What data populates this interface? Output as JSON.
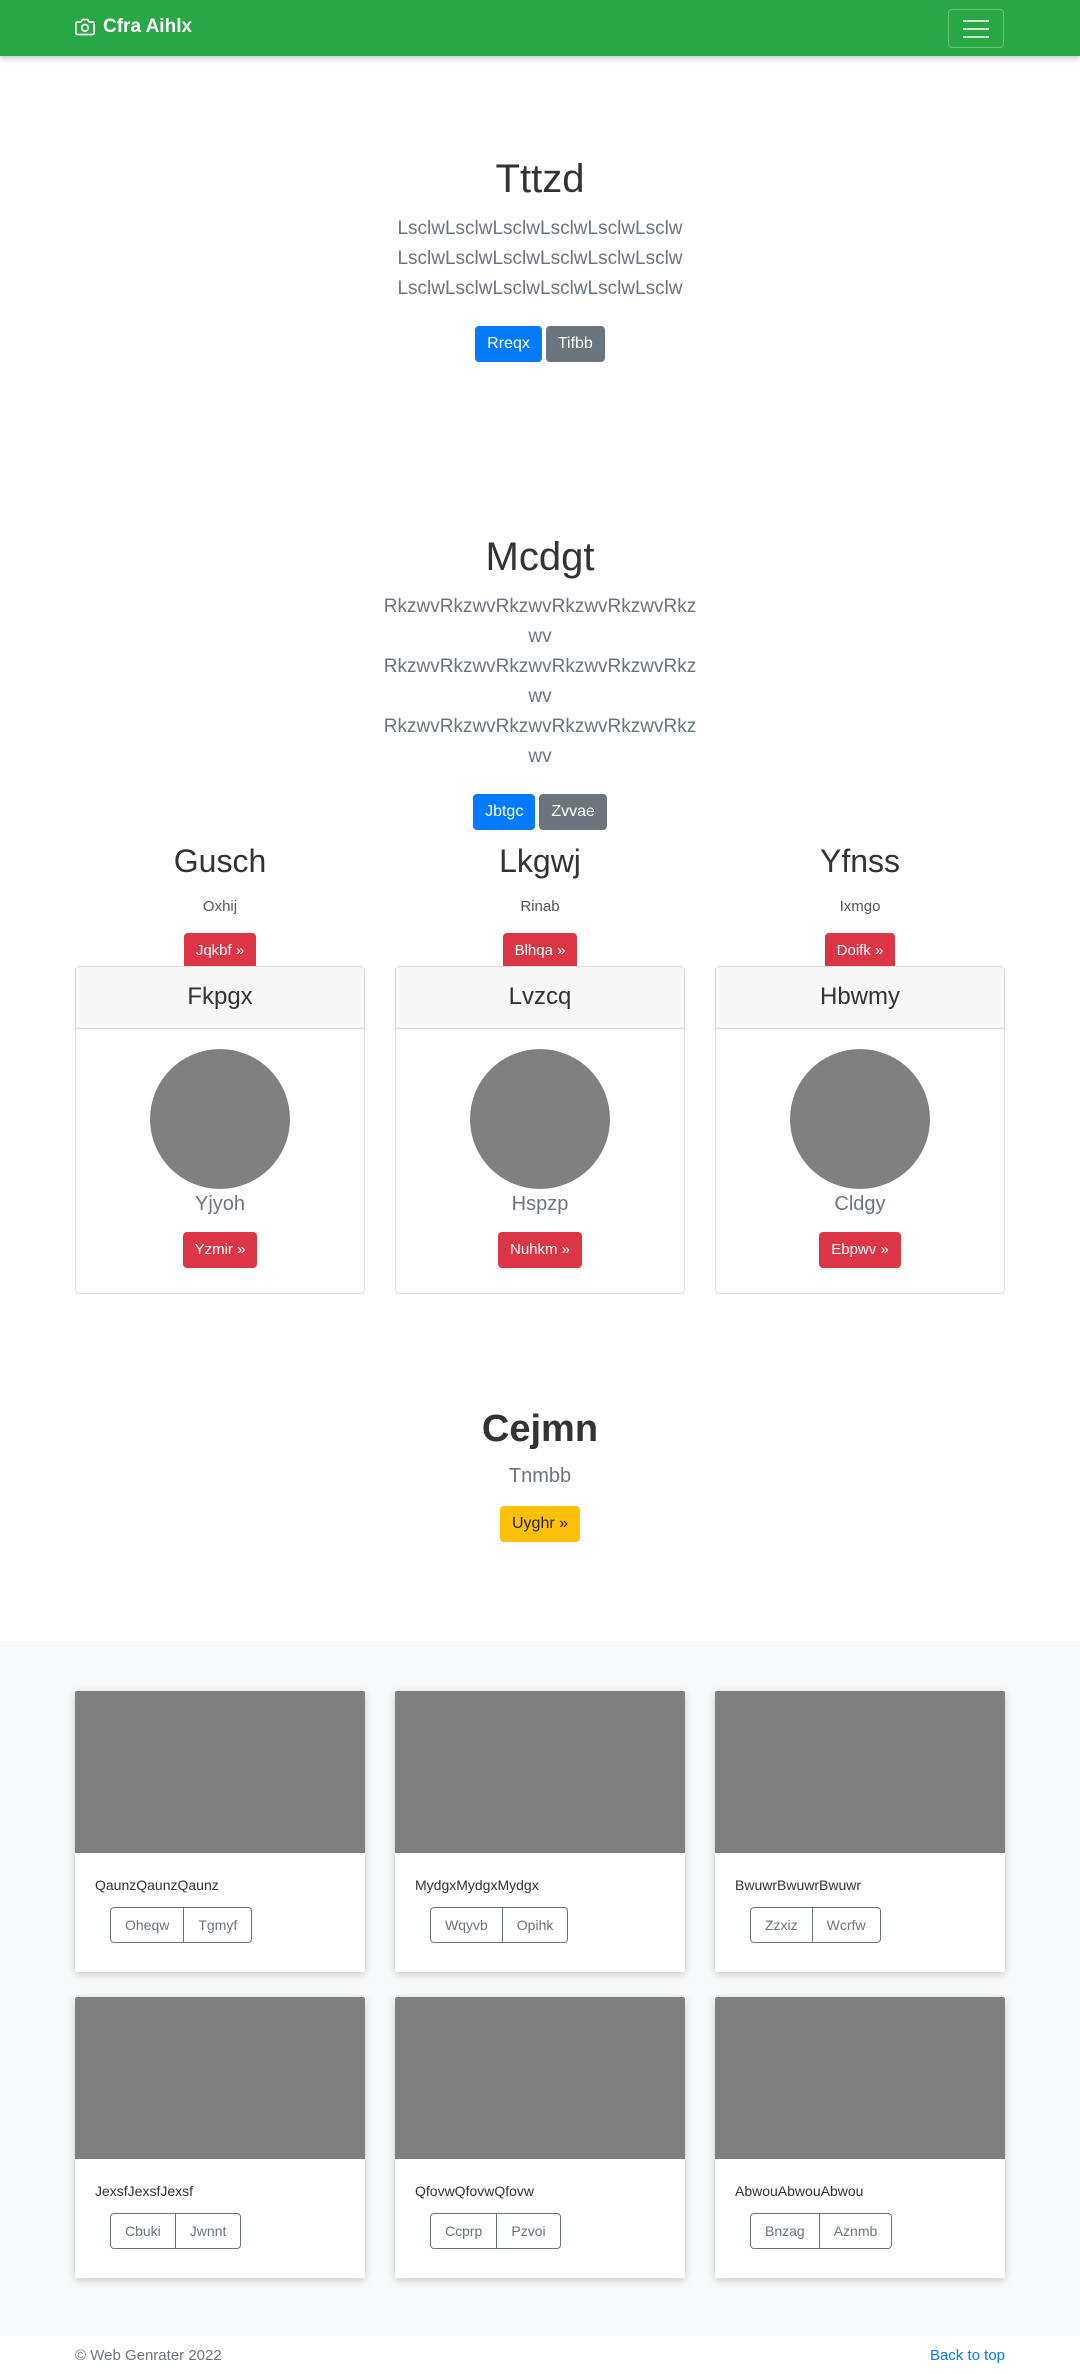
{
  "navbar": {
    "brand": "Cfra Aihlx",
    "brand_icon": "camera-icon",
    "toggler_icon": "hamburger-icon"
  },
  "hero1": {
    "title": "Tttzd",
    "lead": "LsclwLsclwLsclwLsclwLsclwLsclw LsclwLsclwLsclwLsclwLsclwLsclw LsclwLsclwLsclwLsclwLsclwLsclw",
    "btn_primary": "Rreqx",
    "btn_secondary": "Tifbb"
  },
  "hero2": {
    "title": "Mcdgt",
    "lead": "RkzwvRkzwvRkzwvRkzwvRkzwvRkzwv RkzwvRkzwvRkzwvRkzwvRkzwvRkzwv RkzwvRkzwvRkzwvRkzwvRkzwvRkzwv",
    "btn_primary": "Jbtgc",
    "btn_secondary": "Zvvae"
  },
  "columns": [
    {
      "heading": "Gusch",
      "text": "Oxhij",
      "button": "Jqkbf »"
    },
    {
      "heading": "Lkgwj",
      "text": "Rinab",
      "button": "Blhqa »"
    },
    {
      "heading": "Yfnss",
      "text": "Ixmgo",
      "button": "Doifk »"
    }
  ],
  "profile_cards": [
    {
      "header": "Fkpgx",
      "name": "Yjyoh",
      "button": "Yzmir »"
    },
    {
      "header": "Lvzcq",
      "name": "Hspzp",
      "button": "Nuhkm »"
    },
    {
      "header": "Hbwmy",
      "name": "Cldgy",
      "button": "Ebpwv »"
    }
  ],
  "cta": {
    "title": "Cejmn",
    "text": "Tnmbb",
    "button": "Uyghr »"
  },
  "album": [
    {
      "text": "QaunzQaunzQaunz",
      "btn1": "Oheqw",
      "btn2": "Tgmyf"
    },
    {
      "text": "MydgxMydgxMydgx",
      "btn1": "Wqyvb",
      "btn2": "Opihk"
    },
    {
      "text": "BwuwrBwuwrBwuwr",
      "btn1": "Zzxiz",
      "btn2": "Wcrfw"
    },
    {
      "text": "JexsfJexsfJexsf",
      "btn1": "Cbuki",
      "btn2": "Jwnnt"
    },
    {
      "text": "QfovwQfovwQfovw",
      "btn1": "Ccprp",
      "btn2": "Pzvoi"
    },
    {
      "text": "AbwouAbwouAbwou",
      "btn1": "Bnzag",
      "btn2": "Aznmb"
    }
  ],
  "footer": {
    "copyright": "© Web Genrater 2022",
    "back_to_top": "Back to top"
  },
  "colors": {
    "navbar": "#28a745",
    "primary": "#007bff",
    "secondary": "#6c757d",
    "danger": "#dc3545",
    "warning": "#ffc107",
    "placeholder": "#808080"
  }
}
